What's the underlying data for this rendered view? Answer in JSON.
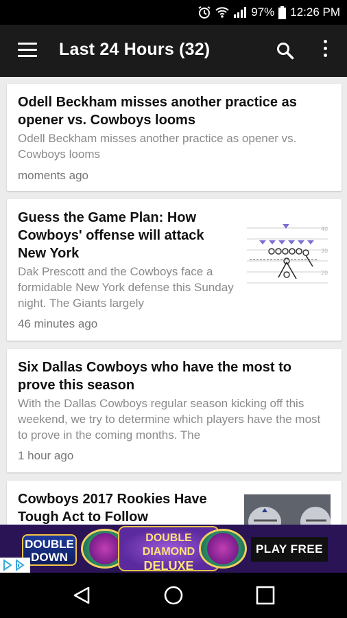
{
  "status_bar": {
    "battery_percent": "97%",
    "time": "12:26 PM",
    "icons": [
      "alarm-icon",
      "wifi-icon",
      "signal-icon",
      "battery-icon"
    ]
  },
  "app_bar": {
    "title": "Last 24 Hours (32)",
    "icons": [
      "menu-icon",
      "search-icon",
      "more-vert-icon"
    ],
    "background": "#1b1b1b"
  },
  "articles": [
    {
      "headline": "Odell Beckham misses another practice as opener vs. Cowboys looms",
      "snippet": "Odell Beckham misses another practice as opener vs. Cowboys looms",
      "time": "moments ago"
    },
    {
      "headline": "Guess the Game Plan: How Cowboys' offense will attack New York",
      "snippet": "Dak Prescott and the Cowboys face a formidable New York defense this Sunday night. The Giants largely",
      "time": "46 minutes ago",
      "thumbnail": "football-play-diagram"
    },
    {
      "headline": "Six Dallas Cowboys who have the most to prove this season",
      "snippet": "With the Dallas Cowboys regular season kicking off this weekend, we try to determine which players have the most to prove in the coming months. The",
      "time": "1 hour ago"
    },
    {
      "headline": "Cowboys 2017 Rookies Have Tough Act to Follow",
      "thumbnail": "cowboys-helmets-photo"
    }
  ],
  "ad": {
    "logo_text_1": "DOUBLE",
    "logo_text_2": "DOWN",
    "center_text_1": "DOUBLE DIAMOND",
    "center_text_2": "DELUXE",
    "cta": "PLAY FREE"
  },
  "nav_bar": {
    "icons": [
      "back-icon",
      "home-icon",
      "recents-icon"
    ]
  }
}
